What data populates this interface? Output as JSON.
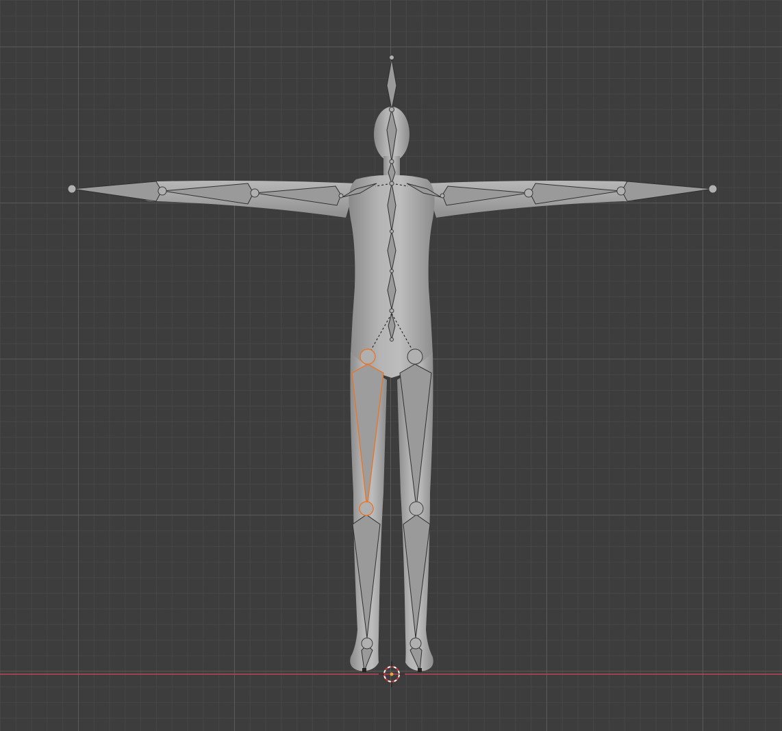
{
  "viewport": {
    "background": "#3d3d3d",
    "grid_minor": "#4a4a4a",
    "grid_major": "#696969",
    "x_axis_color": "#c0425a",
    "selection_color": "#e8762b"
  },
  "scene": {
    "mesh": "humanoid-mesh",
    "armature": "humanoid-armature",
    "selected_bone": "thigh-left-bone",
    "icons": [
      "3d-cursor-icon",
      "origin-icon"
    ]
  }
}
